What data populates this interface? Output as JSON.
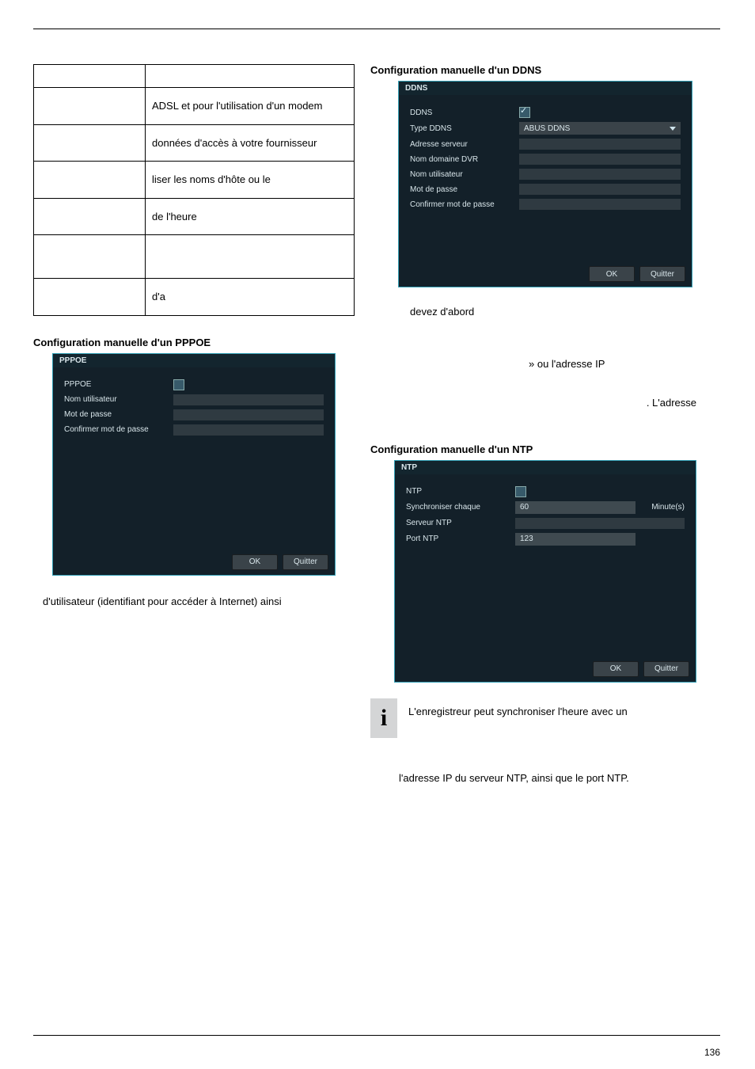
{
  "table_rows": [
    "ADSL et pour l'utilisation d'un modem",
    "données d'accès à votre fournisseur",
    "liser les noms d'hôte ou le",
    "de l'heure",
    "",
    "d'a"
  ],
  "pppoe_heading": "Configuration manuelle d'un PPPOE",
  "pppoe_dialog": {
    "title": "PPPOE",
    "rows": [
      "PPPOE",
      "Nom utilisateur",
      "Mot de passe",
      "Confirmer mot de passe"
    ],
    "ok": "OK",
    "cancel": "Quitter"
  },
  "pppoe_follow": "d'utilisateur (identifiant pour accéder à Internet) ainsi",
  "ddns_heading": "Configuration manuelle d'un DDNS",
  "ddns_dialog": {
    "title": "DDNS",
    "row_ddns": "DDNS",
    "row_type": "Type DDNS",
    "type_value": "ABUS DDNS",
    "row_srv": "Adresse serveur",
    "row_dom": "Nom domaine DVR",
    "row_user": "Nom utilisateur",
    "row_pw": "Mot de passe",
    "row_cpw": "Confirmer mot de passe",
    "ok": "OK",
    "cancel": "Quitter"
  },
  "ddns_follow1": "devez d'abord",
  "ddns_follow2": " » ou l'adresse IP",
  "ddns_follow3": ". L'adresse",
  "ntp_heading": "Configuration manuelle d'un NTP",
  "ntp_dialog": {
    "title": "NTP",
    "row_ntp": "NTP",
    "row_sync": "Synchroniser chaque",
    "sync_value": "60",
    "sync_unit": "Minute(s)",
    "row_srv": "Serveur NTP",
    "row_port": "Port NTP",
    "port_value": "123",
    "ok": "OK",
    "cancel": "Quitter"
  },
  "info_text": "L'enregistreur peut synchroniser l'heure avec un",
  "ntp_follow": "l'adresse IP du serveur NTP, ainsi que le port NTP.",
  "page_no": "136"
}
